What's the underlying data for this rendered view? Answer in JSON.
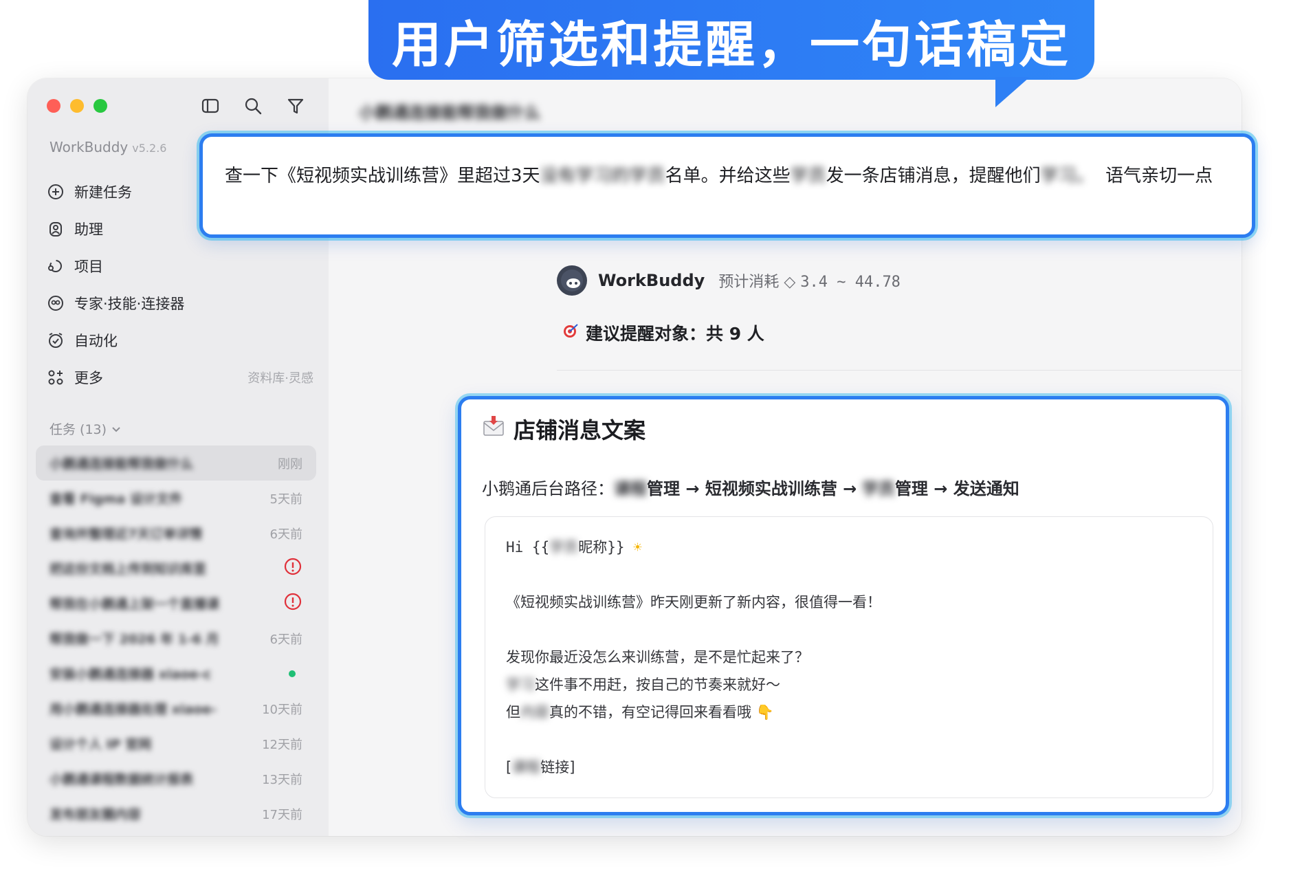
{
  "banner": {
    "text": "用户筛选和提醒，一句话稿定"
  },
  "sidebar": {
    "brand": "WorkBuddy",
    "version": "v5.2.6",
    "nav": [
      {
        "label": "新建任务",
        "icon": "plus-circle-icon"
      },
      {
        "label": "助理",
        "icon": "assistant-icon"
      },
      {
        "label": "项目",
        "icon": "project-icon"
      },
      {
        "label": "专家·技能·连接器",
        "icon": "expert-icon"
      },
      {
        "label": "自动化",
        "icon": "clock-icon"
      },
      {
        "label": "更多",
        "icon": "grid-plus-icon",
        "hint": "资料库·灵感"
      }
    ],
    "tasks_header": "任务 (13)",
    "tasks": [
      {
        "title": "小鹅通连接能帮我做什么",
        "time": "刚刚"
      },
      {
        "title": "查看 Figma 设计文件",
        "time": "5天前"
      },
      {
        "title": "查询并整理近7天订单详情",
        "time": "6天前"
      },
      {
        "title": "把这份文档上传到知识库里",
        "time": ""
      },
      {
        "title": "帮我在小鹅通上架一个直播课",
        "time": ""
      },
      {
        "title": "帮我做一下 2026 年 1-6 月",
        "time": "6天前"
      },
      {
        "title": "安装小鹅通连接器 xiaoe-c",
        "time": ""
      },
      {
        "title": "用小鹅通连接器处理 xiaoe-",
        "time": "10天前"
      },
      {
        "title": "设计个人 IP 官网",
        "time": "12天前"
      },
      {
        "title": "小鹅通课程数据统计报表",
        "time": "13天前"
      },
      {
        "title": "发布朋友圈内容",
        "time": "17天前"
      }
    ]
  },
  "main": {
    "title": "小鹅通连接能帮我做什么",
    "query": {
      "part1": "查一下《短视频实战训练营》里超过3天",
      "blur1": "没有学习的学员",
      "part2": "名单。并给这些",
      "blur2": "学员",
      "part3": "发一条店铺消息，提醒他们",
      "blur3": "学习。",
      "part4": "语气亲切一点"
    },
    "reply": {
      "name": "WorkBuddy",
      "cost_label": "预计消耗",
      "cost_value": "3.4 ~ 44.78",
      "suggest": "建议提醒对象：共 9 人"
    },
    "card": {
      "title": "店铺消息文案",
      "path_label": "小鹅通后台路径：",
      "path_blur1": "课程",
      "path_seg1": "管理 → 短视频实战训练营 →",
      "path_blur2": "学员",
      "path_seg2": "管理 → 发送通知",
      "greeting_pre": "Hi {{",
      "greeting_blur": "学员",
      "greeting_post": "昵称}}",
      "line1": "《短视频实战训练营》昨天刚更新了新内容，很值得一看！",
      "line2": "发现你最近没怎么来训练营，是不是忙起来了？",
      "line3_blur": "学习",
      "line3": "这件事不用赶，按自己的节奏来就好～",
      "line4_pre": "但",
      "line4_blur": "内容",
      "line4": "真的不错，有空记得回来看看哦",
      "link_pre": "[",
      "link_blur": "课程",
      "link_post": "链接]"
    }
  }
}
